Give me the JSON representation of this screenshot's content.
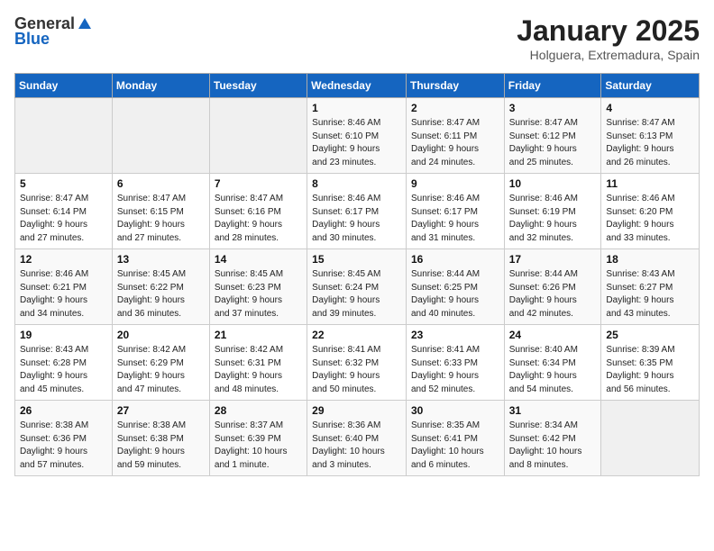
{
  "logo": {
    "general": "General",
    "blue": "Blue"
  },
  "title": "January 2025",
  "subtitle": "Holguera, Extremadura, Spain",
  "days_of_week": [
    "Sunday",
    "Monday",
    "Tuesday",
    "Wednesday",
    "Thursday",
    "Friday",
    "Saturday"
  ],
  "weeks": [
    [
      {
        "day": "",
        "info": ""
      },
      {
        "day": "",
        "info": ""
      },
      {
        "day": "",
        "info": ""
      },
      {
        "day": "1",
        "info": "Sunrise: 8:46 AM\nSunset: 6:10 PM\nDaylight: 9 hours\nand 23 minutes."
      },
      {
        "day": "2",
        "info": "Sunrise: 8:47 AM\nSunset: 6:11 PM\nDaylight: 9 hours\nand 24 minutes."
      },
      {
        "day": "3",
        "info": "Sunrise: 8:47 AM\nSunset: 6:12 PM\nDaylight: 9 hours\nand 25 minutes."
      },
      {
        "day": "4",
        "info": "Sunrise: 8:47 AM\nSunset: 6:13 PM\nDaylight: 9 hours\nand 26 minutes."
      }
    ],
    [
      {
        "day": "5",
        "info": "Sunrise: 8:47 AM\nSunset: 6:14 PM\nDaylight: 9 hours\nand 27 minutes."
      },
      {
        "day": "6",
        "info": "Sunrise: 8:47 AM\nSunset: 6:15 PM\nDaylight: 9 hours\nand 27 minutes."
      },
      {
        "day": "7",
        "info": "Sunrise: 8:47 AM\nSunset: 6:16 PM\nDaylight: 9 hours\nand 28 minutes."
      },
      {
        "day": "8",
        "info": "Sunrise: 8:46 AM\nSunset: 6:17 PM\nDaylight: 9 hours\nand 30 minutes."
      },
      {
        "day": "9",
        "info": "Sunrise: 8:46 AM\nSunset: 6:17 PM\nDaylight: 9 hours\nand 31 minutes."
      },
      {
        "day": "10",
        "info": "Sunrise: 8:46 AM\nSunset: 6:19 PM\nDaylight: 9 hours\nand 32 minutes."
      },
      {
        "day": "11",
        "info": "Sunrise: 8:46 AM\nSunset: 6:20 PM\nDaylight: 9 hours\nand 33 minutes."
      }
    ],
    [
      {
        "day": "12",
        "info": "Sunrise: 8:46 AM\nSunset: 6:21 PM\nDaylight: 9 hours\nand 34 minutes."
      },
      {
        "day": "13",
        "info": "Sunrise: 8:45 AM\nSunset: 6:22 PM\nDaylight: 9 hours\nand 36 minutes."
      },
      {
        "day": "14",
        "info": "Sunrise: 8:45 AM\nSunset: 6:23 PM\nDaylight: 9 hours\nand 37 minutes."
      },
      {
        "day": "15",
        "info": "Sunrise: 8:45 AM\nSunset: 6:24 PM\nDaylight: 9 hours\nand 39 minutes."
      },
      {
        "day": "16",
        "info": "Sunrise: 8:44 AM\nSunset: 6:25 PM\nDaylight: 9 hours\nand 40 minutes."
      },
      {
        "day": "17",
        "info": "Sunrise: 8:44 AM\nSunset: 6:26 PM\nDaylight: 9 hours\nand 42 minutes."
      },
      {
        "day": "18",
        "info": "Sunrise: 8:43 AM\nSunset: 6:27 PM\nDaylight: 9 hours\nand 43 minutes."
      }
    ],
    [
      {
        "day": "19",
        "info": "Sunrise: 8:43 AM\nSunset: 6:28 PM\nDaylight: 9 hours\nand 45 minutes."
      },
      {
        "day": "20",
        "info": "Sunrise: 8:42 AM\nSunset: 6:29 PM\nDaylight: 9 hours\nand 47 minutes."
      },
      {
        "day": "21",
        "info": "Sunrise: 8:42 AM\nSunset: 6:31 PM\nDaylight: 9 hours\nand 48 minutes."
      },
      {
        "day": "22",
        "info": "Sunrise: 8:41 AM\nSunset: 6:32 PM\nDaylight: 9 hours\nand 50 minutes."
      },
      {
        "day": "23",
        "info": "Sunrise: 8:41 AM\nSunset: 6:33 PM\nDaylight: 9 hours\nand 52 minutes."
      },
      {
        "day": "24",
        "info": "Sunrise: 8:40 AM\nSunset: 6:34 PM\nDaylight: 9 hours\nand 54 minutes."
      },
      {
        "day": "25",
        "info": "Sunrise: 8:39 AM\nSunset: 6:35 PM\nDaylight: 9 hours\nand 56 minutes."
      }
    ],
    [
      {
        "day": "26",
        "info": "Sunrise: 8:38 AM\nSunset: 6:36 PM\nDaylight: 9 hours\nand 57 minutes."
      },
      {
        "day": "27",
        "info": "Sunrise: 8:38 AM\nSunset: 6:38 PM\nDaylight: 9 hours\nand 59 minutes."
      },
      {
        "day": "28",
        "info": "Sunrise: 8:37 AM\nSunset: 6:39 PM\nDaylight: 10 hours\nand 1 minute."
      },
      {
        "day": "29",
        "info": "Sunrise: 8:36 AM\nSunset: 6:40 PM\nDaylight: 10 hours\nand 3 minutes."
      },
      {
        "day": "30",
        "info": "Sunrise: 8:35 AM\nSunset: 6:41 PM\nDaylight: 10 hours\nand 6 minutes."
      },
      {
        "day": "31",
        "info": "Sunrise: 8:34 AM\nSunset: 6:42 PM\nDaylight: 10 hours\nand 8 minutes."
      },
      {
        "day": "",
        "info": ""
      }
    ]
  ]
}
